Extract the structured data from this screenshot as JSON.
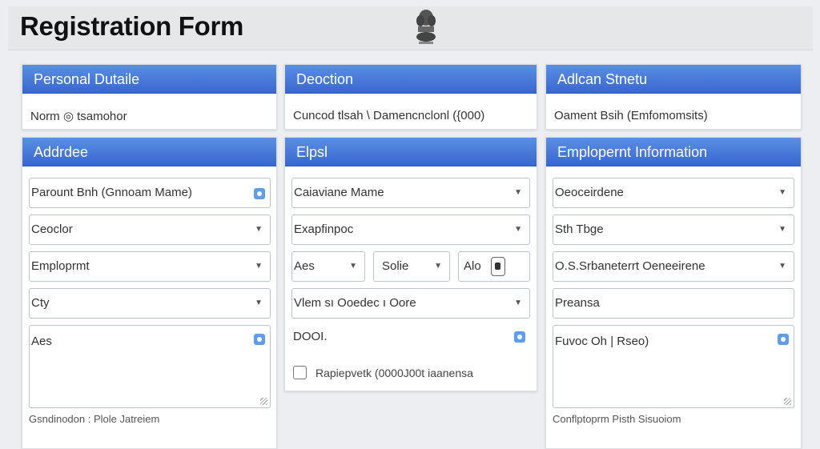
{
  "header": {
    "title": "Registration Form",
    "emblem_icon": "national-emblem-icon"
  },
  "cards": {
    "personal": {
      "title": "Personal Dutaile",
      "text": "Norm ◎ tsamohor"
    },
    "deoction": {
      "title": "Deoction",
      "text": "Cuncod tlsah \\ Damencnclonl ({000)"
    },
    "status": {
      "title": "Adlcan Stnetu",
      "text": "Oament Bsih (Emfomomsits)"
    },
    "address": {
      "title": "Addrdee",
      "fields": [
        "Parount Bnh (Gnnoam Mame)",
        "Ceoclor",
        "Emploprmt",
        "Cty"
      ],
      "textarea": "Aes",
      "helper": "Gsndinodon : Plole Jatreiem"
    },
    "elps": {
      "title": "Elpsl",
      "fields": [
        "Caiaviane Mame",
        "Exapfinpoc"
      ],
      "row": [
        "Aes",
        "Solie",
        "Alo"
      ],
      "field3": "Vlem sı Ooedec ı Oore",
      "textarea": "DOOI.",
      "checkbox_label": "Rapiepvetk (0000J00t iaanensa"
    },
    "employment": {
      "title": "Emplopernt Information",
      "fields": [
        "Oeoceirdene",
        "Sth Tbge",
        "O.S.Srbaneterrt  Oeneeirene"
      ],
      "plain": "Preansa",
      "textarea": "Fuvoc Oh | Rseo)",
      "helper": "Conflptoprm Pisth Sisuoiom"
    }
  },
  "colors": {
    "header_blue": "#3f72d6",
    "accent_icon": "#5e9ef0"
  }
}
